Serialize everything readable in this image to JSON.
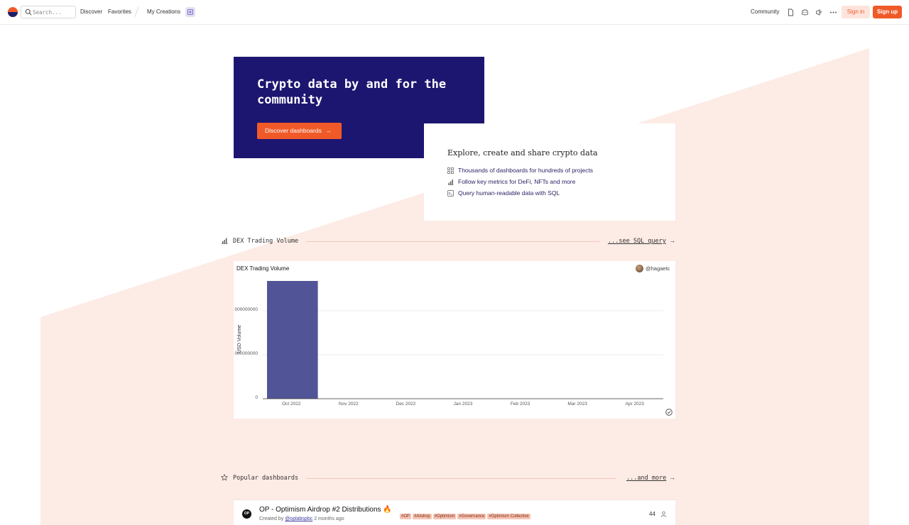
{
  "topbar": {
    "search_placeholder": "Search...",
    "nav": [
      "Discover",
      "Favorites",
      "My Creations"
    ],
    "community": "Community",
    "sign_in": "Sign in",
    "sign_up": "Sign up"
  },
  "hero": {
    "title": "Crypto data by and for the community",
    "cta": "Discover dashboards",
    "cta_arrow": "→"
  },
  "features": {
    "title": "Explore, create and share crypto data",
    "items": [
      {
        "icon": "grid-icon",
        "label": "Thousands of dashboards for hundreds of projects"
      },
      {
        "icon": "bar-chart-icon",
        "label": "Follow key metrics for DeFi, NFTs and more"
      },
      {
        "icon": "terminal-icon",
        "label": "Query human-readable data with SQL"
      }
    ]
  },
  "dex_section": {
    "label": "DEX Trading Volume",
    "link": "...see SQL query",
    "arrow": "→"
  },
  "chart_card": {
    "title": "DEX Trading Volume",
    "author": "@hagaetc",
    "ylabel": "USD Volume",
    "ytick_labels": [
      "000000000",
      "000000000",
      "0"
    ]
  },
  "chart_data": {
    "type": "bar",
    "title": "DEX Trading Volume",
    "xlabel": "",
    "ylabel": "USD Volume",
    "categories": [
      "Oct 2022",
      "Nov 2022",
      "Dec 2022",
      "Jan 2023",
      "Feb 2023",
      "Mar 2023",
      "Apr 2023"
    ],
    "values": [
      2.66,
      0,
      0,
      0,
      0,
      0,
      0
    ],
    "ylim": [
      0,
      2.66
    ],
    "grid": true,
    "colors": {
      "bar": "#525498"
    }
  },
  "popular_section": {
    "label": "Popular dashboards",
    "link": "...and more",
    "arrow": "→"
  },
  "popular": [
    {
      "avatar_text": "OP",
      "title": "OP - Optimism Airdrop #2 Distributions 🔥",
      "tags": [
        "#OP",
        "#Airdrop",
        "#Optimism",
        "#Governance",
        "#Optimism Collective"
      ],
      "created_prefix": "Created by",
      "author": "@oplabspbc",
      "age": "2 months ago",
      "stars": "44"
    }
  ],
  "colors": {
    "brand_orange": "#f05a28",
    "hero_navy": "#1d1670",
    "bg_peach": "#fdebe5"
  }
}
